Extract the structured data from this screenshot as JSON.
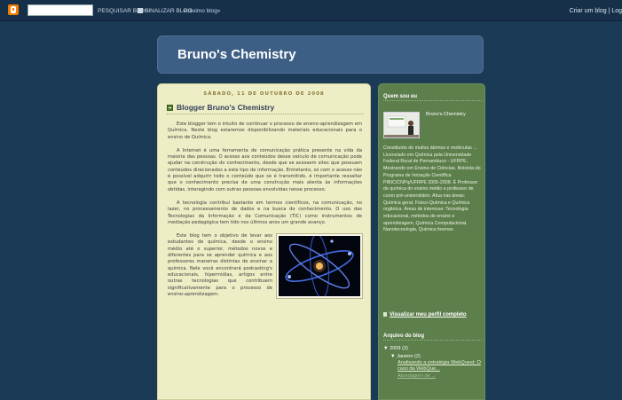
{
  "navbar": {
    "search_value": "",
    "search_blog_label": "PESQUISAR BLOG",
    "flag_blog_label": "SINALIZAR BLOG",
    "next_blog_label": "Próximo blog»",
    "create_blog_label": "Criar um blog | Log",
    "logo_icon": "blogger-logo-icon",
    "accent_color": "#f57d00"
  },
  "header": {
    "title": "Bruno's Chemistry"
  },
  "post": {
    "date": "SÁBADO, 11 DE OUTUBRO DE 2008",
    "title": "Blogger Bruno's Chemistry",
    "paragraphs": [
      "Este blogger tem o intuito de continuar o processo de ensino-aprendizagem em Química. Neste blog estaremos disponibilizando materiais educacionais para o ensino de Química.",
      "A Internet é uma ferramenta de comunicação prática presente na vida da maioria das pessoas. O acesso aos conteúdos desse veículo de comunicação pode ajudar na construção do conhecimento, desde que se acessem sites que possuam conteúdos direcionados a este tipo de informação. Entretanto, só com o acesso não é possível adquirir todo o conteúdo que se é transmitido, é importante ressaltar que o conhecimento precisa de uma construção mais atenta às informações obtidas, interagindo com outras pessoas envolvidas nesse processo.",
      "A tecnologia contribui bastante em termos científicos, na comunicação, no lazer, no processamento de dados e na busca do conhecimento. O uso das Tecnologias da Informação e da Comunicação (TIC) como instrumentos de mediação pedagógica tem tido nos últimos anos um grande avanço.",
      "Este blog tem o objetivo de levar aos estudantes de química, desde o ensino médio até o superior, métodos novos e diferentes para se aprender química e aos professores maneiras distintas de ensinar a química. Nele você encontrará podcasting's educacionais, hipermídias, artigos entre outras tecnologias que contribuem significativamente para o processo de ensino-aprendizagem."
    ],
    "image_icon": "atom-image"
  },
  "sidebar": {
    "profile_heading": "Quem sou eu",
    "profile_name": "Bruno's Chemistry",
    "profile_description": "Constituído de muitos átomos e moléculas ... Licenciado em Química pela Universidade Federal Rural de Pernambuco - UFRPE. Mestrando em Ensino de Ciências. Bolsista do Programa de Iniciação Científica PIBIC/CNPq/UFRPE 2005-2008. É Professor de química do ensino médio e professor de curso pré-universitário. Atua nas áreas: Química geral, Físico-Química e Química orgânica. Áreas de interesse: Tecnologia educacional, métodos de ensino e aprendizagem, Química Computacional, Nanotecnologia, Química forense.",
    "profile_link": "Visualizar meu perfil completo",
    "archive_heading": "Arquivo do blog",
    "archive": {
      "year": "▼ 2009 (2)",
      "month": "▼ Janeiro (2)",
      "posts": [
        "Analisando a estratégia WebQuest: O caso da WebQue...",
        "Abordagem de ..."
      ]
    }
  }
}
